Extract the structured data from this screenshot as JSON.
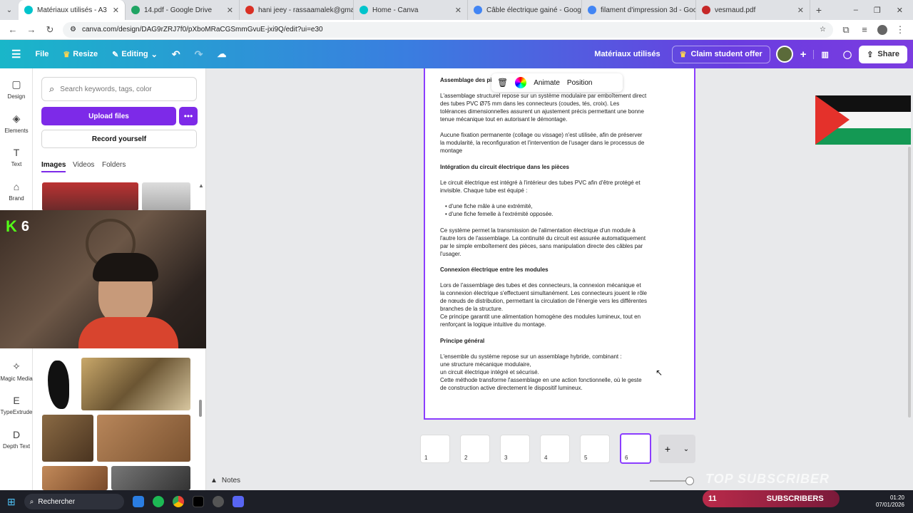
{
  "browser": {
    "tabs": [
      {
        "title": "Matériaux utilisés - A3",
        "color": "#00c4cc",
        "active": true
      },
      {
        "title": "14.pdf - Google Drive",
        "color": "#1fa463"
      },
      {
        "title": "hani jeey - rassaamalek@gmail",
        "color": "#d93025"
      },
      {
        "title": "Home - Canva",
        "color": "#00c4cc"
      },
      {
        "title": "Câble électrique gainé - Google",
        "color": "#4285f4"
      },
      {
        "title": "filament d'impression 3d - Goo",
        "color": "#4285f4"
      },
      {
        "title": "vesmaud.pdf",
        "color": "#c62828"
      }
    ],
    "url": "canva.com/design/DAG9rZRJ7f0/pXboMRaCGSmmGvuE-jxi9Q/edit?ui=e30"
  },
  "header": {
    "file": "File",
    "resize": "Resize",
    "editing": "Editing",
    "doc_title": "Matériaux utilisés",
    "claim": "Claim student offer",
    "share": "Share"
  },
  "rail": [
    {
      "label": "Design",
      "icon": "▢"
    },
    {
      "label": "Elements",
      "icon": "◈"
    },
    {
      "label": "Text",
      "icon": "T"
    },
    {
      "label": "Brand",
      "icon": "⌂"
    },
    {
      "label": "Magic Media",
      "icon": "✧"
    },
    {
      "label": "TypeExtrude",
      "icon": "E"
    },
    {
      "label": "Depth Text",
      "icon": "D"
    }
  ],
  "panel": {
    "search_placeholder": "Search keywords, tags, color",
    "upload": "Upload files",
    "record": "Record yourself",
    "tabs": [
      "Images",
      "Videos",
      "Folders"
    ]
  },
  "overlay_badge": "6",
  "toolbar": {
    "animate": "Animate",
    "position": "Position"
  },
  "document": {
    "h1": "Assemblage des pièc",
    "p1": "   L'assemblage structurel repose sur un système modulaire par emboîtement direct des tubes PVC Ø75 mm dans les connecteurs (coudes, tés, croix). Les tolérances dimensionnelles assurent un ajustement précis permettant une bonne tenue mécanique tout en autorisant le démontage.",
    "p2": " Aucune fixation permanente (collage ou vissage) n'est utilisée, afin de préserver la modularité, la reconfiguration et l'intervention de l'usager dans le processus de montage",
    "h2": "Intégration du circuit électrique dans les pièces",
    "p3": "   Le circuit électrique est intégré à l'intérieur des tubes PVC afin d'être protégé et invisible. Chaque tube est équipé :",
    "b1": "d'une fiche mâle à une extrémité,",
    "b2": "d'une fiche femelle à l'extrémité opposée.",
    "p4": "   Ce système permet la transmission de l'alimentation électrique d'un module à l'autre lors de l'assemblage. La continuité du circuit est assurée automatiquement par le simple emboîtement des pièces, sans manipulation directe des câbles par l'usager.",
    "h3": "Connexion électrique entre les modules",
    "p5": "   Lors de l'assemblage des tubes et des connecteurs, la connexion mécanique et la connexion électrique s'effectuent simultanément. Les connecteurs jouent le rôle de nœuds de distribution, permettant la circulation de l'énergie vers les différentes branches de la structure.",
    "p6": " Ce principe garantit une alimentation homogène des modules lumineux, tout en renforçant la logique intuitive du montage.",
    "h4": "Principe général",
    "p7": "   L'ensemble du système repose sur un assemblage hybride, combinant :",
    "p8": "une structure mécanique modulaire,",
    "p9": "un circuit électrique intégré et sécurisé.",
    "p10": "Cette méthode transforme l'assemblage en une action fonctionnelle, où le geste de construction active directement le dispositif lumineux."
  },
  "pages": [
    "1",
    "2",
    "3",
    "4",
    "5",
    "6"
  ],
  "notes": "Notes",
  "taskbar": {
    "search": "Rechercher",
    "time": "01:20",
    "date": "07/01/2026"
  },
  "subs": {
    "count": "11",
    "label": "SUBSCRIBERS"
  },
  "watermark": "TOP SUBSCRIBER"
}
